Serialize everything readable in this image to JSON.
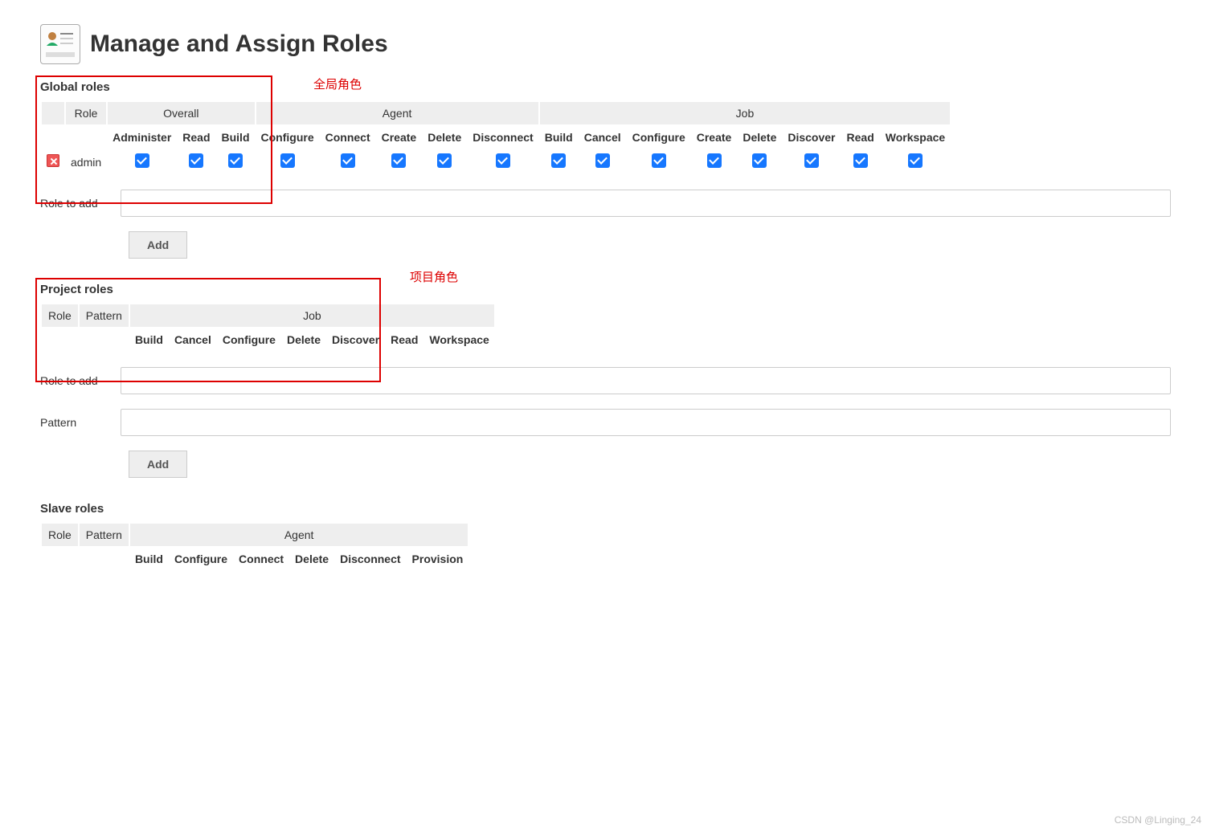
{
  "page": {
    "title": "Manage and Assign Roles"
  },
  "annotations": {
    "global": "全局角色",
    "project": "项目角色"
  },
  "global": {
    "title": "Global roles",
    "group_role": "Role",
    "groups": {
      "overall": {
        "label": "Overall",
        "cols": [
          "Administer",
          "Read",
          "Build"
        ]
      },
      "agent": {
        "label": "Agent",
        "cols": [
          "Configure",
          "Connect",
          "Create",
          "Delete",
          "Disconnect"
        ]
      },
      "job": {
        "label": "Job",
        "cols": [
          "Build",
          "Cancel",
          "Configure",
          "Create",
          "Delete",
          "Discover",
          "Read",
          "Workspace"
        ]
      }
    },
    "rows": [
      {
        "name": "admin",
        "checked": [
          true,
          true,
          true,
          true,
          true,
          true,
          true,
          true,
          true,
          true,
          true,
          true,
          true,
          true,
          true,
          true
        ]
      }
    ],
    "form": {
      "role_label": "Role to add",
      "role_value": "",
      "add_label": "Add"
    }
  },
  "project": {
    "title": "Project roles",
    "group_role": "Role",
    "group_pattern": "Pattern",
    "groups": {
      "job": {
        "label": "Job",
        "cols": [
          "Build",
          "Cancel",
          "Configure",
          "Delete",
          "Discover",
          "Read",
          "Workspace"
        ]
      }
    },
    "form": {
      "role_label": "Role to add",
      "role_value": "",
      "pattern_label": "Pattern",
      "pattern_value": "",
      "add_label": "Add"
    }
  },
  "slave": {
    "title": "Slave roles",
    "group_role": "Role",
    "group_pattern": "Pattern",
    "groups": {
      "agent": {
        "label": "Agent",
        "cols": [
          "Build",
          "Configure",
          "Connect",
          "Delete",
          "Disconnect",
          "Provision"
        ]
      }
    }
  },
  "watermark": "CSDN @Linging_24"
}
